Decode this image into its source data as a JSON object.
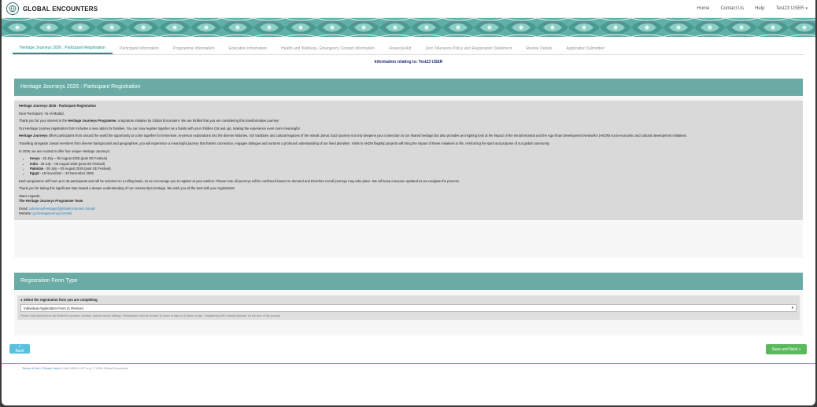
{
  "header": {
    "brand": "GLOBAL ENCOUNTERS",
    "nav": [
      "Home",
      "Contact Us",
      "Help"
    ],
    "user_menu": "Test23 USER"
  },
  "tabs": [
    "Heritage Journeys 2026 : Participant Registration",
    "Participant Information",
    "Programme Information",
    "Education Information",
    "Health and Wellness, Emergency Contact Information",
    "Financial Aid",
    "Zero Tolerance Policy and Registration Statement",
    "Review Details",
    "Application Submitted"
  ],
  "info_line": "Information relating to: Test23 USER",
  "intro": {
    "panel_title": "Heritage Journeys 2026 : Participant Registration",
    "heading": "Heritage Journeys 2026 : Participant Registration",
    "greeting": "Dear Participant, Ya Ali Madad,",
    "p1_pre": "Thank you for your interest in the ",
    "p1_bold": "Heritage Journeys Programme",
    "p1_post": ", a signature initiative by Global Encounters. We are thrilled that you are considering this transformative journey!",
    "p2": "Our Heritage Journey registration form includes a new option for families. You can now register together as a family with your children (16 and up), making the experience even more meaningful.",
    "p3_bold": "Heritage Journeys",
    "p3_post": " offers participants from around the world the opportunity to come together for immersive, in-person explorations into the diverse histories, rich traditions and cultural legacies of the Ismaili Jamat. Each journey not only deepens your connection to our shared heritage but also provides an inspiring look at the impact of the Ismaili Imamat and the Aga Khan Development Network's (AKDN) socio-economic and cultural development initiatives.",
    "p4": "Travelling alongside Jamati members from diverse backgrounds and geographies, you will experience a meaningful journey that fosters connection, engages dialogue and nurtures a profound understanding of our lived pluralism. Visits to AKDN flagship projects will bring the impact of these initiatives to life, reinforcing the spirit and purpose of our global community.",
    "p5": "In 2026, we are excited to offer four unique Heritage Journeys:",
    "journeys": [
      {
        "name": "Kenya",
        "dates": " - 28 July – 05 August 2026 (post GE Festival)"
      },
      {
        "name": "India",
        "dates": " - 28 July – 05 August 2026 (post GE Festival)"
      },
      {
        "name": "Pakistan",
        "dates": " - 28 July – 05 August 2026 (post GE Festival)"
      },
      {
        "name": "Egypt",
        "dates": " - 15 November – 23 November 2026"
      }
    ],
    "p6": "Each programme will host up to 35 participants and will be selected on a rolling basis, so we encourage you to register at your earliest. Please note all journeys will be confirmed based on demand and therefore not all journeys may take place. We will keep everyone updated as we navigate the process.",
    "p7": "Thank you for taking this significant step toward a deeper understanding of our community's heritage. We wish you all the best with your registration!",
    "regards": "Warm regards,",
    "team": "The Heritage Journeys Programme Team",
    "email_label": "Email: ",
    "email": "cultureandheritage@globalencounters.ismaili",
    "website_label": "Website: ",
    "website": "ge.heritagejourneys.ismaili"
  },
  "registration": {
    "panel_title": "Registration Form Type",
    "select_label": "Select the registration form you are completing",
    "selected": "Individual Application Form (1 Person)",
    "note": "Please note family forms are limited to spouses, children, parents and/or siblings. Participants must be at least 18 years of age or 16 years of age, if registering with a family member, by the time of the journey."
  },
  "buttons": {
    "back": "« Back",
    "next": "Save and Next »"
  },
  "footer": {
    "terms": "Terms of Use",
    "privacy": "Privacy Notice",
    "rest": " | HW-2/B/10-1577-v.a | © 2026 Global Encounters"
  },
  "colors": {
    "teal": "#6aaca5",
    "tab_active": "#2f8a82",
    "next": "#5cb85c",
    "back": "#5bc0de"
  }
}
